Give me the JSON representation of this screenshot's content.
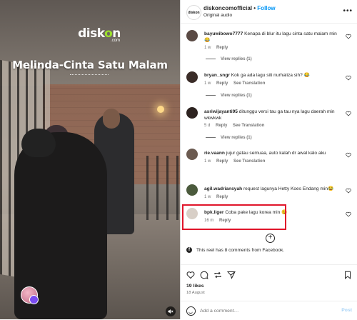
{
  "video": {
    "logo_text": "disk",
    "logo_dot": "o",
    "logo_text2": "n",
    "logo_sub": ".com",
    "caption": "Melinda-Cinta Satu Malam"
  },
  "header": {
    "username": "diskoncomofficial",
    "separator": "•",
    "follow_label": "Follow",
    "audio": "Original audio",
    "avatar_text": "diskon"
  },
  "comments": [
    {
      "username": "bayuwibowo7777",
      "text": "Kenapa di blur itu lagu cinta satu malam min 😂",
      "time": "1 w",
      "reply_label": "Reply",
      "translate_label": "",
      "view_replies": "View replies (1)",
      "avatar_color": "#5a4a44"
    },
    {
      "username": "bryan_sngr",
      "text": "Kok ga ada lagu siti nurhaliza sih? 😂",
      "time": "1 w",
      "reply_label": "Reply",
      "translate_label": "See Translation",
      "view_replies": "View replies (1)",
      "avatar_color": "#3a2c28"
    },
    {
      "username": "asriwijayanti95",
      "text": "ditunggu versi tau ga tau nya lagu daerah min wkwkwk",
      "time": "5 d",
      "reply_label": "Reply",
      "translate_label": "See Translation",
      "view_replies": "View replies (1)",
      "avatar_color": "#2d2320"
    },
    {
      "username": "rie.vaann",
      "text": "jujur gatau semuaa, auto kalah dr awal kalo aku",
      "time": "1 w",
      "reply_label": "Reply",
      "translate_label": "See Translation",
      "view_replies": "",
      "avatar_color": "#6b5a50"
    },
    {
      "username": "agil.wadriansyah",
      "text": "request lagunya Hetty Koes Endang min😂",
      "time": "1 w",
      "reply_label": "Reply",
      "translate_label": "",
      "view_replies": "",
      "avatar_color": "#4b5a3c"
    },
    {
      "username": "bpk.liger",
      "text": "Coba pake lagu korea min 😉",
      "time": "16 m",
      "reply_label": "Reply",
      "translate_label": "",
      "view_replies": "",
      "avatar_color": "#d8cfc7"
    }
  ],
  "load_more_symbol": "+",
  "facebook_note": "This reel has 8 comments from Facebook.",
  "facebook_icon": "f",
  "likes": "19 likes",
  "date": "18 August",
  "composer": {
    "placeholder": "Add a comment…",
    "post_label": "Post"
  },
  "colors": {
    "accent": "#0095f6",
    "highlight": "#e0162b",
    "post_disabled": "#a8d3f6"
  }
}
